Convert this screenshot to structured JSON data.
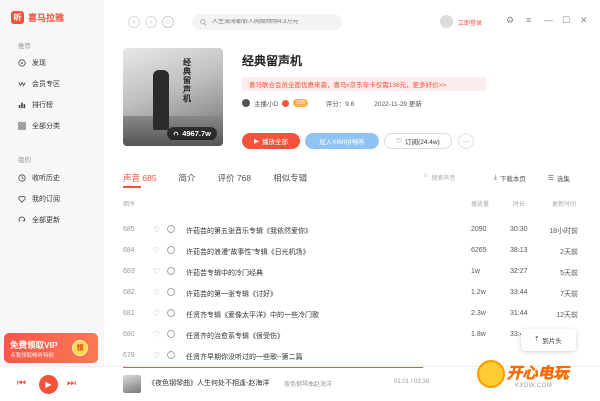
{
  "app": {
    "name": "喜马拉雅",
    "logo_glyph": "听"
  },
  "sidebar": {
    "section1": "推荐",
    "items1": [
      {
        "label": "发现",
        "icon": "discover-icon"
      },
      {
        "label": "会员专区",
        "icon": "vip-icon"
      },
      {
        "label": "排行榜",
        "icon": "ranking-icon"
      },
      {
        "label": "全部分类",
        "icon": "category-icon"
      }
    ],
    "section2": "我的",
    "items2": [
      {
        "label": "收听历史",
        "icon": "history-icon"
      },
      {
        "label": "我的订阅",
        "icon": "subscribe-icon"
      },
      {
        "label": "全部更新",
        "icon": "update-icon"
      }
    ],
    "vip_banner": {
      "title": "免费领取VIP",
      "subtitle": "点我领取畅听特权",
      "coin": "领"
    }
  },
  "topbar": {
    "search_placeholder": "人生海海都依人网络频频4.3万元",
    "login_text": "立即登录"
  },
  "album": {
    "title": "经典留声机",
    "cover_vertical_text": "经典留声机",
    "play_count": "4967.7w",
    "promo": "喜马联合会员全面优惠来袭，喜马x京东年卡仅需138元，更多好价>>",
    "host": "主播小D",
    "level_badge": "LV8",
    "score_label": "评分：9.6",
    "update_date": "2022-11-29 更新",
    "buttons": {
      "play_all": "播放全部",
      "xim": "加入XIMI拼畅听",
      "subscribe": "订阅(24.4w)",
      "more": "···"
    }
  },
  "tabs": [
    {
      "label": "声音 685",
      "active": true
    },
    {
      "label": "简介",
      "active": false
    },
    {
      "label": "评价 768",
      "active": false
    },
    {
      "label": "相似专辑",
      "active": false
    }
  ],
  "list_search_placeholder": "搜索声音",
  "tools": {
    "download": "下载本页",
    "select": "选集"
  },
  "columns": {
    "index": "倒序",
    "plays": "播放量",
    "duration": "时长",
    "updated": "更新时间"
  },
  "tracks": [
    {
      "index": "685",
      "title": "许茹芸的第五张音乐专辑《我依然爱你》",
      "plays": "2090",
      "duration": "30:30",
      "updated": "18小时前"
    },
    {
      "index": "684",
      "title": "许茹芸的浪漫“故事性”专辑《日光机场》",
      "plays": "6265",
      "duration": "38:13",
      "updated": "2天前"
    },
    {
      "index": "683",
      "title": "许茹芸专辑中的冷门经典",
      "plays": "1w",
      "duration": "32:27",
      "updated": "5天前"
    },
    {
      "index": "682",
      "title": "许茹芸的第一张专辑《讨好》",
      "plays": "1.2w",
      "duration": "33:44",
      "updated": "7天前"
    },
    {
      "index": "681",
      "title": "任贤齐专辑《爱像太平洋》中的一些冷门歌",
      "plays": "2.3w",
      "duration": "31:44",
      "updated": "12天前"
    },
    {
      "index": "680",
      "title": "任贤齐的治愈系专辑《很受伤》",
      "plays": "1.8w",
      "duration": "33:44",
      "updated": ""
    },
    {
      "index": "679",
      "title": "任贤齐早期你没听过的一些歌--第二篇",
      "plays": "",
      "duration": "",
      "updated": ""
    }
  ],
  "popup": {
    "label": "到片头"
  },
  "player": {
    "title": "《夜色钢琴曲》人生何处不相逢-赵海洋",
    "album": "夜色钢琴曲赵海洋",
    "time": "01:01 / 03:38"
  },
  "watermark": {
    "text": "开心电玩",
    "url": "KXDW.COM"
  },
  "colors": {
    "accent": "#f4523b",
    "xim_blue": "#8ec3f4"
  }
}
